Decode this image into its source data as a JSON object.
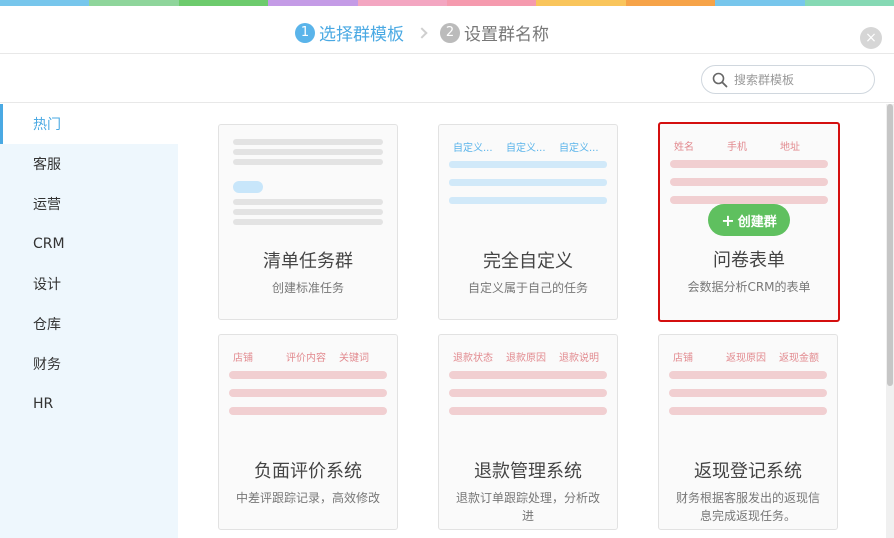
{
  "colors": {
    "top_strip": [
      "#77c6ec",
      "#8fd59b",
      "#6dcb6d",
      "#c49be6",
      "#f3a6c1",
      "#f59aae",
      "#f9c55c",
      "#f6a348",
      "#77c6ec",
      "#86d9b4"
    ],
    "accent": "#4aa9e3",
    "selected_border": "#d40f0f",
    "create_button": "#5fc05f"
  },
  "steps": [
    {
      "num": "1",
      "label": "选择群模板"
    },
    {
      "num": "2",
      "label": "设置群名称"
    }
  ],
  "close_icon": "×",
  "search": {
    "placeholder": "搜索群模板"
  },
  "sidebar": {
    "items": [
      {
        "label": "热门"
      },
      {
        "label": "客服"
      },
      {
        "label": "运营"
      },
      {
        "label": "CRM"
      },
      {
        "label": "设计"
      },
      {
        "label": "仓库"
      },
      {
        "label": "财务"
      },
      {
        "label": "HR"
      }
    ]
  },
  "templates": [
    {
      "title": "清单任务群",
      "desc": "创建标准任务",
      "headers": []
    },
    {
      "title": "完全自定义",
      "desc": "自定义属于自己的任务",
      "headers": [
        "自定义...",
        "自定义...",
        "自定义..."
      ]
    },
    {
      "title": "问卷表单",
      "desc": "会数据分析CRM的表单",
      "headers": [
        "姓名",
        "手机",
        "地址"
      ],
      "create_label": "创建群",
      "plus": "+"
    },
    {
      "title": "负面评价系统",
      "desc": "中差评跟踪记录，高效修改",
      "headers": [
        "店铺",
        "评价内容",
        "关键词"
      ]
    },
    {
      "title": "退款管理系统",
      "desc": "退款订单跟踪处理，分析改进",
      "headers": [
        "退款状态",
        "退款原因",
        "退款说明"
      ]
    },
    {
      "title": "返现登记系统",
      "desc": "财务根据客服发出的返现信息完成返现任务。",
      "headers": [
        "店铺",
        "返现原因",
        "返现金额"
      ]
    }
  ]
}
